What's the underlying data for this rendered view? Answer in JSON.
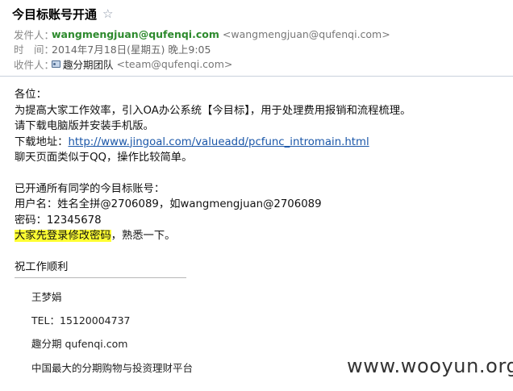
{
  "email": {
    "subject": "今目标账号开通",
    "star_icon": "☆",
    "from": {
      "label": "发件人：",
      "name": "wangmengjuan@qufenqi.com",
      "address": "<wangmengjuan@qufenqi.com>"
    },
    "time": {
      "label": "时　间：",
      "value": "2014年7月18日(星期五) 晚上9:05"
    },
    "to": {
      "label": "收件人：",
      "icon": "contact-card-icon",
      "name": "趣分期团队",
      "address": "<team@qufenqi.com>"
    }
  },
  "body": {
    "greeting": "各位：",
    "intro": "为提高大家工作效率，引入OA办公系统【今目标】，用于处理费用报销和流程梳理。",
    "download_note": "请下载电脑版并安装手机版。",
    "download_label": "下载地址：",
    "download_link": "http://www.jingoal.com/valueadd/pcfunc_intromain.html",
    "chat_note": "聊天页面类似于QQ，操作比较简单。",
    "account_intro": "已开通所有同学的今目标账号：",
    "username_line": "用户名：姓名全拼@2706089，如wangmengjuan@2706089",
    "password_line": "密码：12345678",
    "highlight_text": "大家先登录修改密码",
    "highlight_suffix": "，熟悉一下。",
    "closing": "祝工作顺利"
  },
  "signature": {
    "name": "王梦娟",
    "tel": "TEL：15120004737",
    "company": "趣分期 qufenqi.com",
    "slogan": "中国最大的分期购物与投资理财平台"
  },
  "watermark": "www.wooyun.org"
}
